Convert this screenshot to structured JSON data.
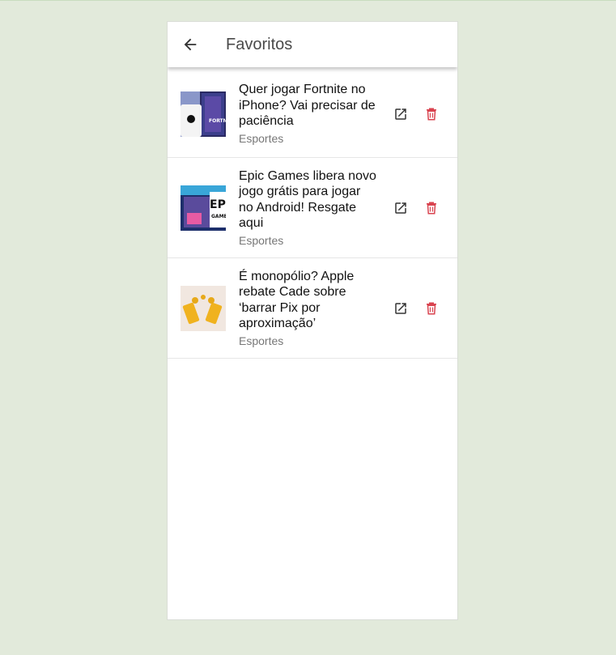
{
  "header": {
    "title": "Favoritos",
    "back_icon": "arrow-back-icon"
  },
  "favorites": [
    {
      "headline": "Quer jogar Fortnite no iPhone? Vai precisar de paciência",
      "category": "Esportes"
    },
    {
      "headline": "Epic Games libera novo jogo grátis para jogar no Android! Resgate aqui",
      "category": "Esportes"
    },
    {
      "headline": "É monopólio? Apple rebate Cade sobre ‘barrar Pix por aproximação’",
      "category": "Esportes"
    }
  ],
  "icons": {
    "open": "open-external-icon",
    "delete": "trash-icon"
  },
  "colors": {
    "background": "#e2eadb",
    "delete": "#d9434f",
    "text": "#111111",
    "category": "#777777"
  }
}
